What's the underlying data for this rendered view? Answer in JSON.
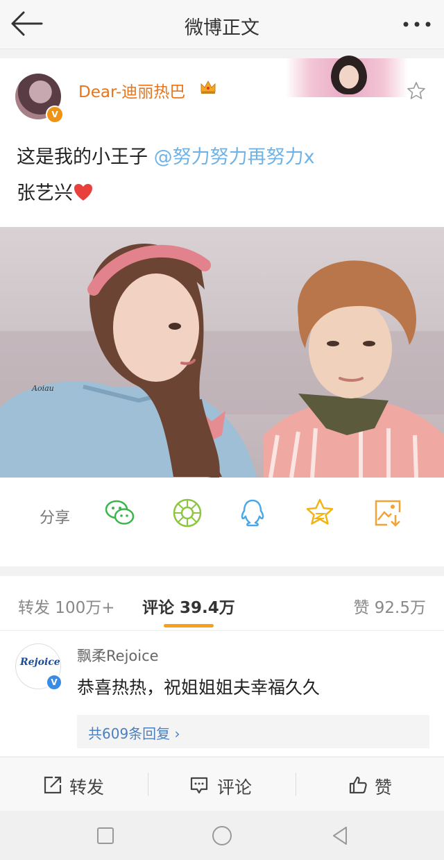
{
  "header": {
    "title": "微博正文"
  },
  "post": {
    "username": "Dear-迪丽热巴",
    "verified_badge": "V",
    "text_line1": "这是我的小王子 ",
    "mention": "@努力努力再努力x",
    "text_line2": "张艺兴",
    "watermark": "Aoiau"
  },
  "share": {
    "label": "分享",
    "icons": [
      "wechat-icon",
      "moments-icon",
      "qq-icon",
      "favorite-icon",
      "save-image-icon"
    ]
  },
  "stats": {
    "repost": "转发 100万+",
    "comment": "评论 39.4万",
    "like": "赞 92.5万"
  },
  "comment": {
    "avatar_logo": "Rejoice",
    "verified_badge": "V",
    "name": "飘柔Rejoice",
    "text": "恭喜热热，祝姐姐姐夫幸福久久",
    "replies": "共609条回复 ›"
  },
  "bottom": {
    "repost": "转发",
    "comment": "评论",
    "like": "赞"
  },
  "colors": {
    "accent": "#f7a11b",
    "username": "#e8751a",
    "mention": "#6fb3e6",
    "link": "#4a7fc1"
  }
}
